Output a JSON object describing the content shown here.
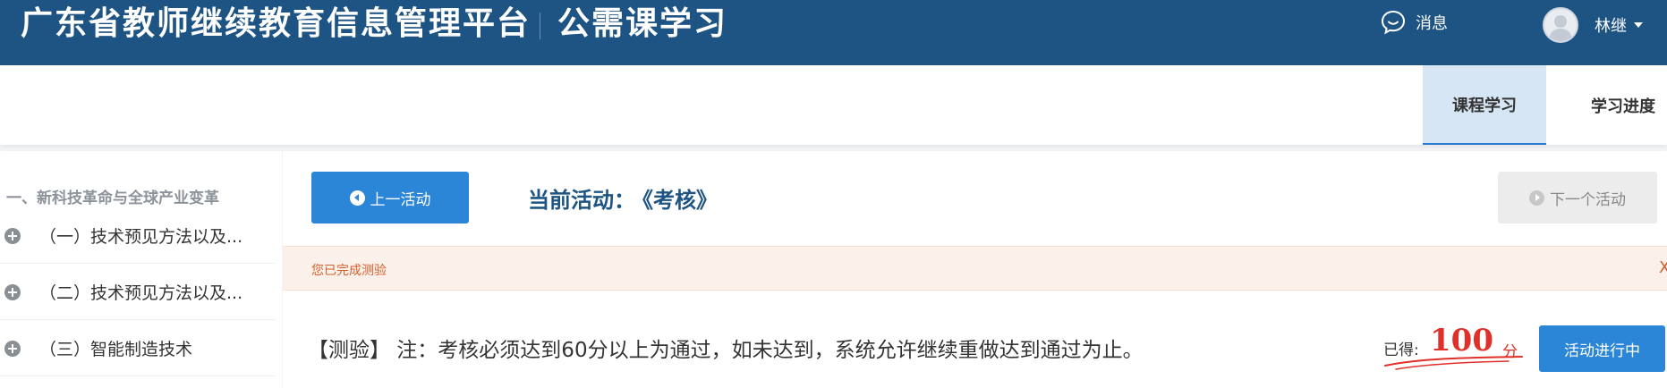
{
  "header": {
    "site_title": "广东省教师继续教育信息管理平台",
    "sub_title": "公需课学习",
    "messages_label": "消息",
    "user_name": "林继",
    "bg_color": "#1e5483"
  },
  "topnav": {
    "tabs": [
      {
        "label": "课程学习",
        "active": true
      },
      {
        "label": "学习进度",
        "active": false
      }
    ]
  },
  "sidebar": {
    "chapter": "一、新科技革命与全球产业变革",
    "items": [
      {
        "label": "（一）技术预见方法以及..."
      },
      {
        "label": "（二）技术预见方法以及..."
      },
      {
        "label": "（三）智能制造技术"
      }
    ]
  },
  "activity": {
    "prev_label": "上一活动",
    "current_prefix": "当前活动：",
    "current_value": "《考核》",
    "next_label": "下一个活动",
    "notice": "您已完成测验",
    "notice_close": "X",
    "quiz_text": "【测验】 注：考核必须达到60分以上为通过，如未达到，系统允许继续重做达到通过为止。",
    "score_label": "已得:",
    "score_value": "100",
    "score_unit": "分",
    "status_label": "活动进行中",
    "accent_color": "#2b86d8",
    "score_color": "#e0302a"
  }
}
